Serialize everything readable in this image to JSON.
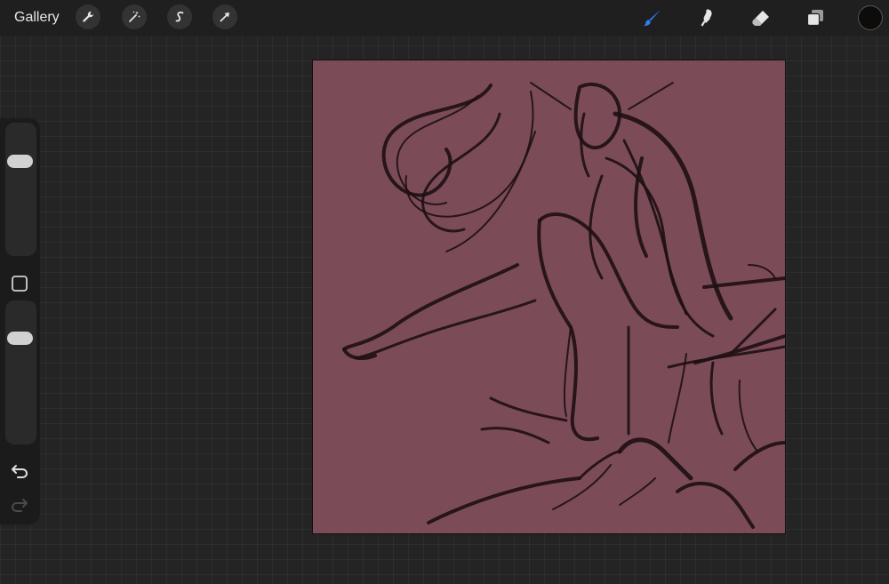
{
  "topbar": {
    "gallery_label": "Gallery",
    "actions": [
      {
        "icon": "wrench-icon"
      },
      {
        "icon": "magic-wand-icon"
      },
      {
        "icon": "selection-icon"
      },
      {
        "icon": "transform-arrow-icon"
      }
    ],
    "tools": [
      {
        "icon": "brush-icon",
        "active": true,
        "color": "#2f7ef6"
      },
      {
        "icon": "smudge-icon",
        "active": false
      },
      {
        "icon": "eraser-icon",
        "active": false
      },
      {
        "icon": "layers-icon",
        "active": false
      }
    ],
    "current_color": "#0e0b0b"
  },
  "sidebar": {
    "brush_size_level": 0.75,
    "opacity_level": 0.78,
    "modify_icon": "modify-square-icon",
    "undo_icon": "undo-icon",
    "redo_icon": "redo-icon",
    "redo_enabled": false
  },
  "canvas": {
    "background_color": "#7b4c58",
    "stroke_color": "#1e1013"
  },
  "colors": {
    "app_background": "#242424",
    "topbar": "#1f1f1f",
    "active_tool": "#2f7ef6"
  }
}
